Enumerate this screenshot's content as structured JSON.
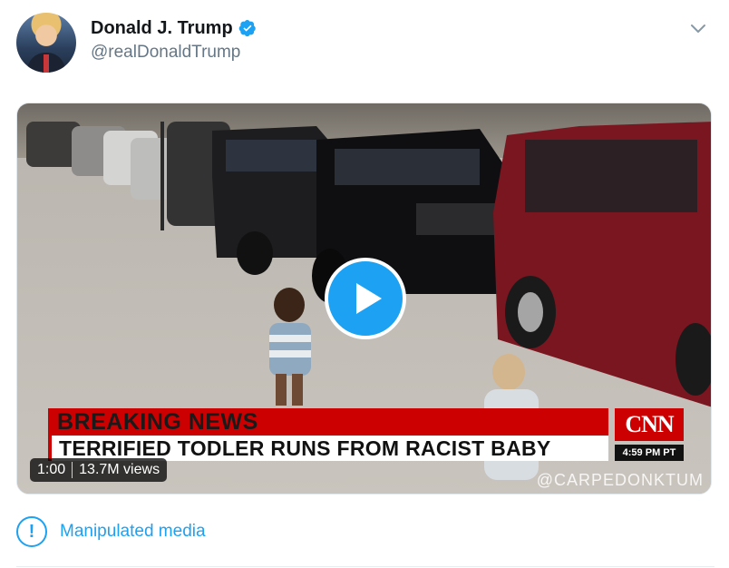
{
  "tweet": {
    "author_name": "Donald J. Trump",
    "handle": "@realDonaldTrump"
  },
  "video": {
    "duration": "1:00",
    "views": "13.7M views",
    "breaking_label": "BREAKING NEWS",
    "headline": "TERRIFIED TODLER RUNS FROM RACIST BABY",
    "network_logo": "CNN",
    "timestamp": "4:59 PM PT",
    "watermark": "@CARPEDONKTUM"
  },
  "notice": {
    "label": "Manipulated media",
    "icon": "!"
  },
  "colors": {
    "accent": "#1da1f2",
    "breaking_red": "#cc0000"
  },
  "icons": {
    "verified": "verified-badge-icon",
    "menu": "chevron-down-icon",
    "play": "play-icon",
    "alert": "exclamation-circle-icon"
  }
}
